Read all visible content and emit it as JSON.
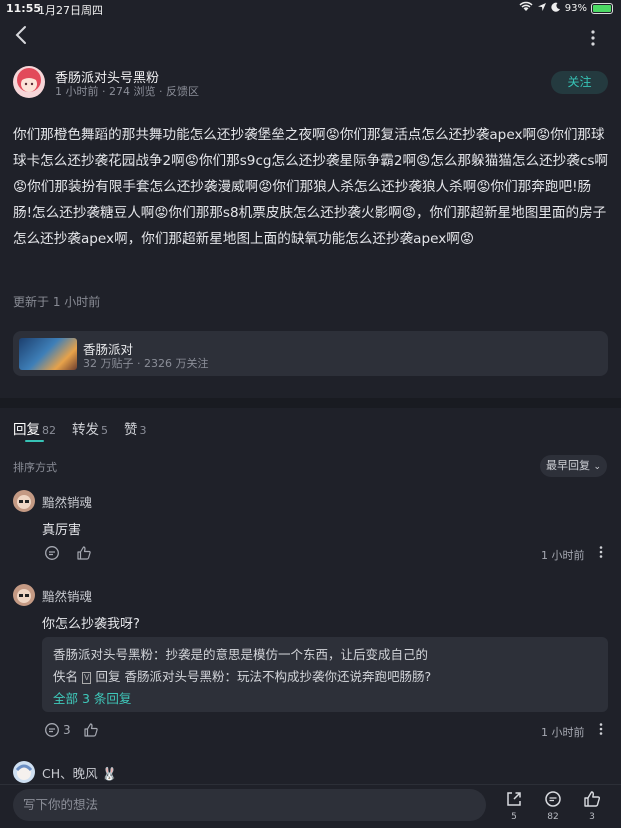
{
  "status_bar": {
    "time": "11:55",
    "date": "1月27日周四",
    "battery": "93%"
  },
  "author": {
    "name": "香肠派对头号黑粉",
    "meta": "1 小时前 · 274 浏览 · 反馈区",
    "follow_label": "关注"
  },
  "post": {
    "body": "你们那橙色舞蹈的那共舞功能怎么还抄袭堡垒之夜啊😡你们那复活点怎么还抄袭apex啊😡你们那球球卡怎么还抄袭花园战争2啊😡你们那s9cg怎么还抄袭星际争霸2啊😡怎么那躲猫猫怎么还抄袭cs啊😡你们那装扮有限手套怎么还抄袭漫威啊😡你们那狼人杀怎么还抄袭狼人杀啊😡你们那奔跑吧!肠肠!怎么还抄袭糖豆人啊😡你们那那s8机票皮肤怎么还抄袭火影啊😡，你们那超新星地图里面的房子怎么还抄袭apex啊，你们那超新星地图上面的缺氧功能怎么还抄袭apex啊😡",
    "updated": "更新于 1 小时前"
  },
  "forum": {
    "name": "香肠派对",
    "stats": "32 万贴子 · 2326 万关注"
  },
  "tabs": [
    {
      "label": "回复",
      "count": "82"
    },
    {
      "label": "转发",
      "count": "5"
    },
    {
      "label": "赞",
      "count": "3"
    }
  ],
  "sort": {
    "label": "排序方式",
    "button": "最早回复"
  },
  "comments": [
    {
      "name": "黯然销魂",
      "text": "真厉害",
      "time": "1 小时前"
    },
    {
      "name": "黯然销魂",
      "text": "你怎么抄袭我呀?",
      "time": "1 小时前",
      "reply_count": "3",
      "replies": [
        {
          "author": "香肠派对头号黑粉",
          "text": "抄袭是的意思是模仿一个东西，让后变成自己的"
        },
        {
          "prefix": "佚名",
          "badge": "V",
          "action": "回复",
          "target": "香肠派对头号黑粉",
          "text": "玩法不构成抄袭你还说奔跑吧肠肠?"
        }
      ],
      "all_replies_link": "全部 3 条回复"
    },
    {
      "name": "CH、晚风",
      "emoji": "🐰"
    }
  ],
  "bottom_bar": {
    "placeholder": "写下你的想法",
    "share_count": "5",
    "comment_count": "82",
    "like_count": "3"
  },
  "colors": {
    "accent": "#37c3b6",
    "background": "#1f2129",
    "card": "#2d3039"
  }
}
